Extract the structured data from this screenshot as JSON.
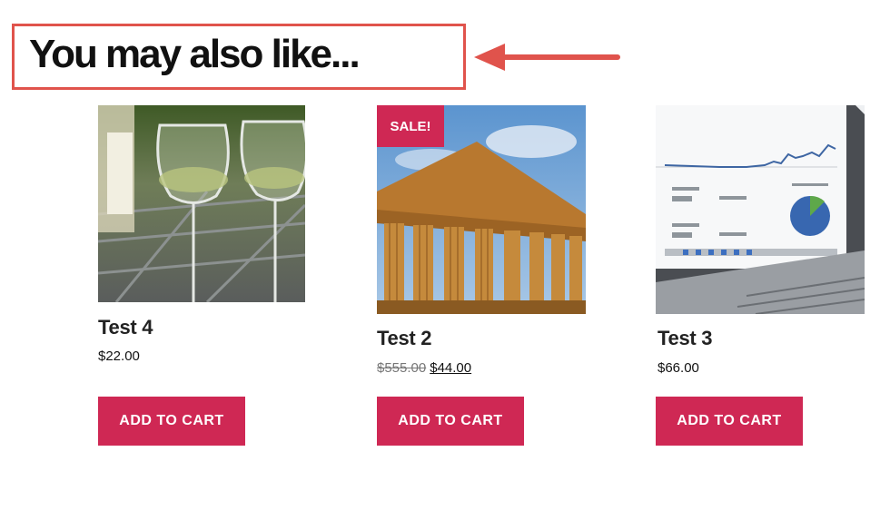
{
  "section": {
    "heading": "You may also like..."
  },
  "colors": {
    "highlight_border": "#e0534c",
    "button_bg": "#cf2854"
  },
  "products": [
    {
      "title": "Test 4",
      "price": "$22.00",
      "button_label": "ADD TO CART",
      "image": "wine-glasses-image"
    },
    {
      "title": "Test 2",
      "badge": "SALE!",
      "old_price": "$555.00",
      "price": "$44.00",
      "button_label": "ADD TO CART",
      "image": "greek-temple-image"
    },
    {
      "title": "Test 3",
      "price": "$66.00",
      "button_label": "ADD TO CART",
      "image": "laptop-analytics-image"
    }
  ]
}
